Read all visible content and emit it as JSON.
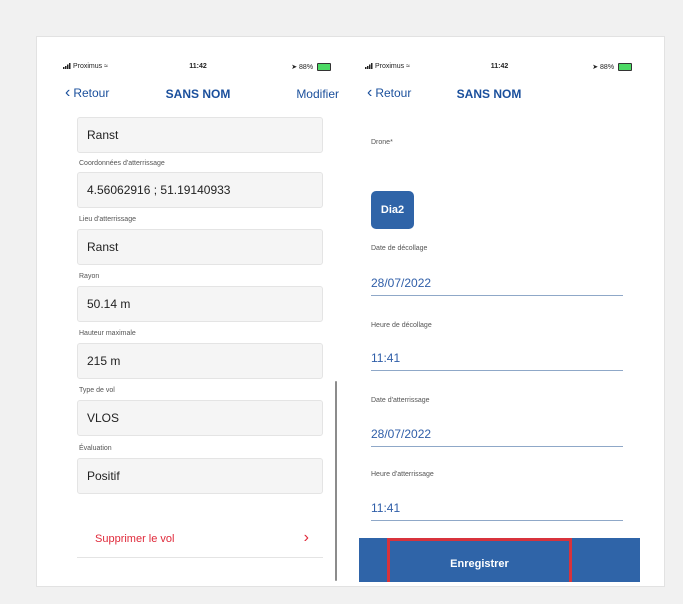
{
  "left_phone": {
    "status": {
      "carrier": "Proximus",
      "time": "11:42",
      "battery": "88%"
    },
    "nav": {
      "back": "Retour",
      "title": "SANS NOM",
      "action": "Modifier"
    },
    "fields": [
      {
        "label": "",
        "value": "Ranst"
      },
      {
        "label": "Coordonnées d'atterrissage",
        "value": "4.56062916 ; 51.19140933"
      },
      {
        "label": "Lieu d'atterrissage",
        "value": "Ranst"
      },
      {
        "label": "Rayon",
        "value": "50.14 m"
      },
      {
        "label": "Hauteur maximale",
        "value": "215 m"
      },
      {
        "label": "Type de vol",
        "value": "VLOS"
      },
      {
        "label": "Évaluation",
        "value": "Positif"
      }
    ],
    "delete": {
      "label": "Supprimer le vol",
      "chevron": "›"
    }
  },
  "right_phone": {
    "status": {
      "carrier": "Proximus",
      "time": "11:42",
      "battery": "88%"
    },
    "nav": {
      "back": "Retour",
      "title": "SANS NOM"
    },
    "drone": {
      "label": "Drone*",
      "value": "Dia2"
    },
    "fields": [
      {
        "label": "Date de décollage",
        "value": "28/07/2022"
      },
      {
        "label": "Heure de décollage",
        "value": "11:41"
      },
      {
        "label": "Date d'atterrissage",
        "value": "28/07/2022"
      },
      {
        "label": "Heure d'atterrissage",
        "value": "11:41"
      }
    ],
    "save": {
      "label": "Enregistrer"
    }
  },
  "colors": {
    "accent": "#2f64a8",
    "danger": "#e0293a",
    "highlight": "#d8333c"
  }
}
